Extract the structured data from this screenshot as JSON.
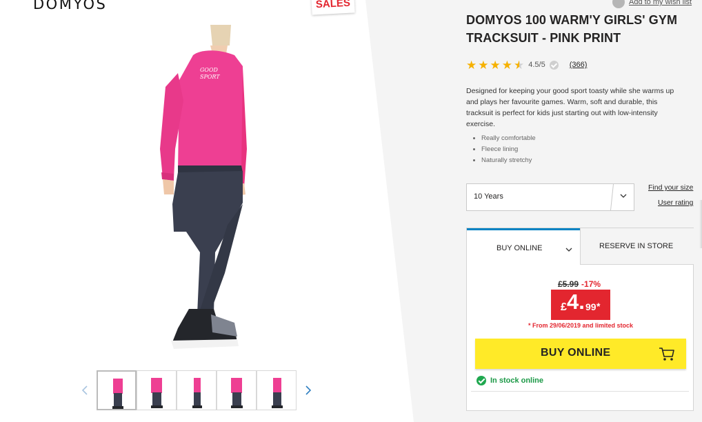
{
  "brand": {
    "logo_text": "DOMYOS"
  },
  "sale_badge": "SALES",
  "header": {
    "wishlist_label": "Add to my wish list"
  },
  "product": {
    "title": "DOMYOS 100 WARM'Y GIRLS' GYM TRACKSUIT - PINK PRINT",
    "rating": {
      "value_text": "4.5/5",
      "stars": 4.5,
      "review_count": "(366)"
    },
    "description": "Designed for keeping your good sport toasty while she warms up and plays her favourite games. Warm, soft and durable, this tracksuit is perfect for kids just starting out with low-intensity exercise.",
    "features": [
      "Really comfortable",
      "Fleece lining",
      "Naturally stretchy"
    ],
    "print_text": "GOOD SPORT"
  },
  "size": {
    "selected": "10 Years",
    "find_size_link": "Find your size",
    "user_rating_link": "User rating"
  },
  "purchase": {
    "tabs": {
      "online": "BUY ONLINE",
      "store": "RESERVE IN STORE"
    },
    "old_price": "£5.99",
    "discount": "-17%",
    "price": {
      "currency": "£",
      "integer": "4.",
      "decimals": "99",
      "asterisk": "*"
    },
    "stock_note": "* From 29/06/2019 and limited stock",
    "buy_button": "BUY ONLINE",
    "in_stock": "In stock online"
  },
  "thumbnails": {
    "count": 5
  },
  "colors": {
    "accent_blue": "#0082c3",
    "price_red": "#e3262f",
    "buy_yellow": "#ffea28",
    "stock_green": "#1fa84f",
    "sweater_pink": "#ee3f93",
    "pants_navy": "#3a3f4f"
  }
}
